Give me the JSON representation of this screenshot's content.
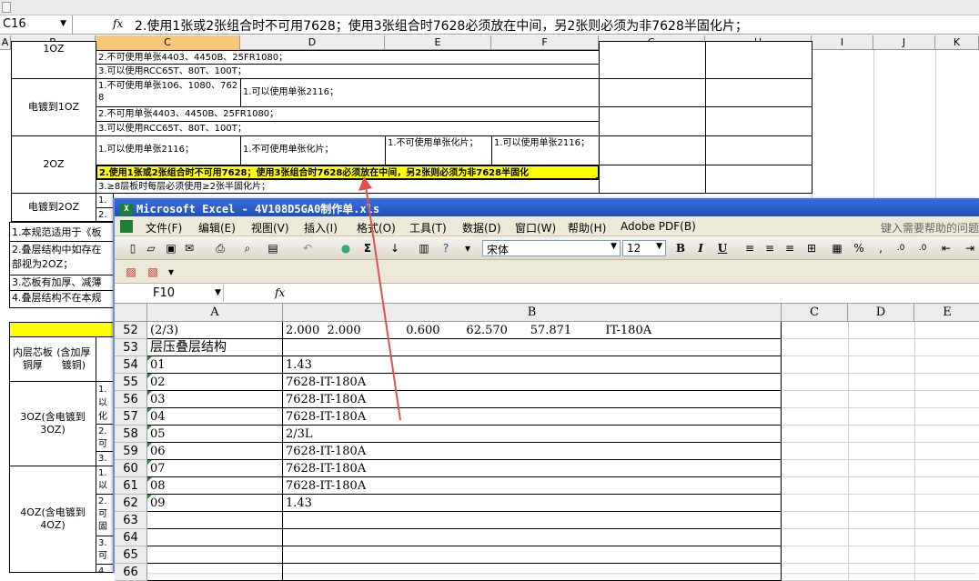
{
  "back_window": {
    "name_box": "C16",
    "formula": "2.使用1张或2张组合时不可用7628；使用3张组合时7628必须放在中间，另2张则必须为非7628半固化片；",
    "columns": [
      "A",
      "B",
      "C",
      "D",
      "E",
      "F",
      "G",
      "H",
      "I",
      "J",
      "K"
    ],
    "rows": {
      "r1_b": "1OZ",
      "r1_c2": "2.不可使用单张4403、4450B、25FR1080；",
      "r1_c3": "3.可以使用RCC65T、80T、100T；",
      "r2_b": "电镀到1OZ",
      "r2_c1": "1.不可使用单张106、1080、7628",
      "r2_d1": "1.可以使用单张2116；",
      "r2_c2": "2.不可用单张4403、4450B、25FR1080；",
      "r2_c3": "3.可以使用RCC65T、80T、100T；",
      "r3_b": "2OZ",
      "r3_c1": "1.可以使用单张2116；",
      "r3_d1": "1.不可使用单张化片；",
      "r3_e1": "1.不可使用单张化片；",
      "r3_f1": "1.可以使用单张2116；",
      "r3_c2": "2.使用1张或2张组合时不可用7628；使用3张组合时7628必须放在中间，另2张则必须为非7628半固化",
      "r3_c3": "3.≥8层板时每层必须使用≥2张半固化片；",
      "r4_b": "电镀到2OZ",
      "r4_c1": "1.",
      "r4_c2": "2.",
      "note1": "1.本规范适用于《板",
      "note2a": "2.叠层结构中如存在",
      "note2b": "部视为2OZ；",
      "note3": "3.芯板有加厚、减薄",
      "note4": "4.叠层结构不在本规",
      "sec_hdr1": "内层芯板铜厚",
      "sec_hdr2": "(含加厚镀铜)",
      "sec_30z": "3OZ(含电镀到3OZ)",
      "sec_40z": "4OZ(含电镀到4OZ)",
      "s30_c1": "1.",
      "s30_c1b": "以",
      "s30_c1c": "化",
      "s30_c2": "2.",
      "s30_c2b": "可",
      "s30_c3": "3.",
      "s40_c1": "1.",
      "s40_c1b": "以",
      "s40_c2": "2.",
      "s40_c2b": "可",
      "s40_c2c": "固",
      "s40_c3": "3.",
      "s40_c3b": "可",
      "s40_c4": "4."
    }
  },
  "excel": {
    "title": "Microsoft Excel - 4V108D5GA0制作单.xls",
    "menus": [
      "文件(F)",
      "编辑(E)",
      "视图(V)",
      "插入(I)",
      "格式(O)",
      "工具(T)",
      "数据(D)",
      "窗口(W)",
      "帮助(H)",
      "Adobe PDF(B)"
    ],
    "help_box": "键入需要帮助的问题",
    "font_name": "宋体",
    "font_size": "12",
    "name_box": "F10",
    "columns": [
      "A",
      "B",
      "C",
      "D",
      "E"
    ],
    "rows": [
      {
        "n": "52",
        "a": "(2/3)",
        "b": "2.000  2.000            0.600       62.570      57.871         IT-180A",
        "tri": false
      },
      {
        "n": "53",
        "a": "层压叠层结构",
        "b": "",
        "tri": false
      },
      {
        "n": "54",
        "a": "01",
        "b": "1.43",
        "tri": true
      },
      {
        "n": "55",
        "a": "02",
        "b": "7628-IT-180A",
        "tri": true
      },
      {
        "n": "56",
        "a": "03",
        "b": "7628-IT-180A",
        "tri": true
      },
      {
        "n": "57",
        "a": "04",
        "b": "7628-IT-180A",
        "tri": true
      },
      {
        "n": "58",
        "a": "05",
        "b": "2/3L",
        "tri": true
      },
      {
        "n": "59",
        "a": "06",
        "b": "7628-IT-180A",
        "tri": true
      },
      {
        "n": "60",
        "a": "07",
        "b": "7628-IT-180A",
        "tri": true
      },
      {
        "n": "61",
        "a": "08",
        "b": "7628-IT-180A",
        "tri": true
      },
      {
        "n": "62",
        "a": "09",
        "b": "1.43",
        "tri": true
      },
      {
        "n": "63",
        "a": "",
        "b": "",
        "tri": false
      },
      {
        "n": "64",
        "a": "",
        "b": "",
        "tri": false
      },
      {
        "n": "65",
        "a": "",
        "b": "",
        "tri": false
      },
      {
        "n": "66",
        "a": "",
        "b": "",
        "tri": false
      }
    ]
  },
  "colors": {
    "highlight": "#ffff00",
    "arrow": "#e05050",
    "title_bar": "#2a5bc6"
  }
}
